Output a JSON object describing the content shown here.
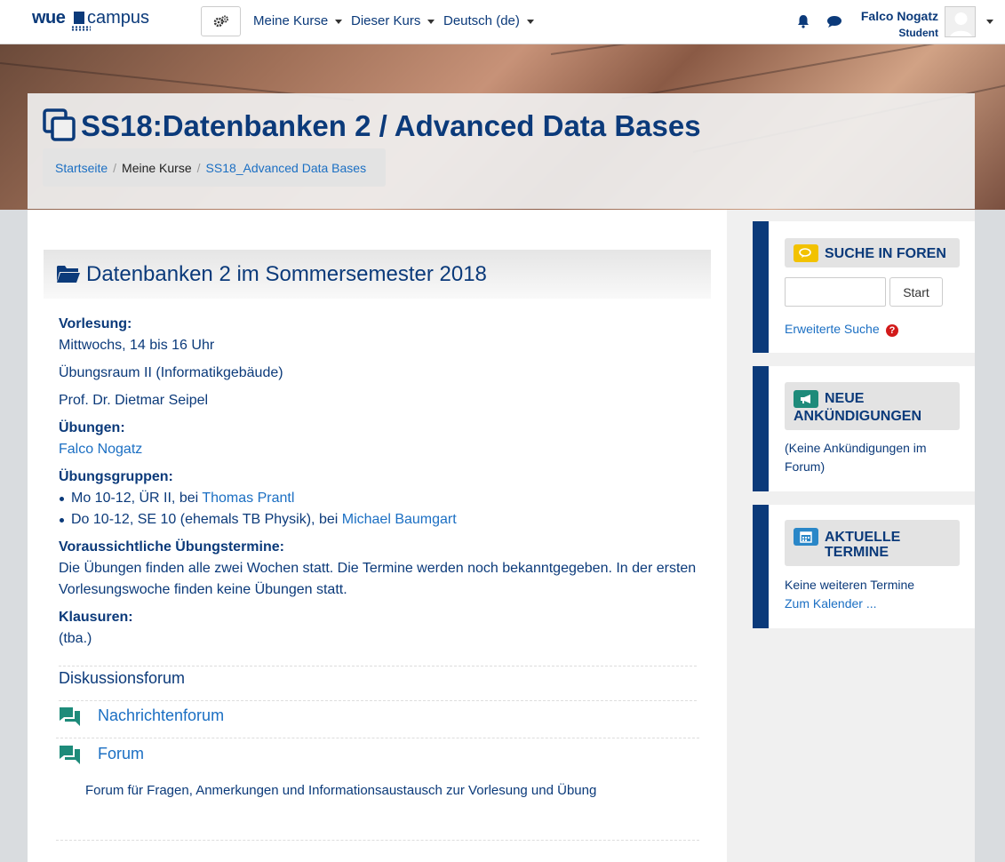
{
  "navbar": {
    "logo_text_bold": "wue",
    "logo_text": "campus",
    "menus": [
      "Meine Kurse",
      "Dieser Kurs",
      "Deutsch (de)"
    ],
    "user_name": "Falco Nogatz",
    "user_role": "Student"
  },
  "header": {
    "title": "SS18:Datenbanken 2 / Advanced Data Bases",
    "breadcrumb": [
      "Startseite",
      "Meine Kurse",
      "SS18_Advanced Data Bases"
    ]
  },
  "section": {
    "title": "Datenbanken 2 im Sommersemester 2018",
    "vorlesung_label": "Vorlesung:",
    "vorlesung_time": "Mittwochs, 14 bis 16 Uhr",
    "vorlesung_room": "Übungsraum II (Informatikgebäude)",
    "vorlesung_prof": "Prof. Dr. Dietmar Seipel",
    "uebungen_label": "Übungen:",
    "uebungen_tutor": "Falco Nogatz",
    "gruppen_label": "Übungsgruppen:",
    "gruppe1_text": "Mo 10-12, ÜR II, bei ",
    "gruppe1_tutor": "Thomas Prantl",
    "gruppe2_text": "Do 10-12, SE 10 (ehemals TB Physik), bei ",
    "gruppe2_tutor": "Michael Baumgart",
    "termine_label": "Voraussichtliche Übungstermine:",
    "termine_line1": "Die Übungen finden alle zwei Wochen statt. Die Termine werden noch bekanntgegeben. In der ersten",
    "termine_line2": "Vorlesungswoche finden keine Übungen statt.",
    "klausuren_label": "Klausuren:",
    "klausuren_value": "(tba.)",
    "diskussion_label": "Diskussionsforum",
    "forum1": "Nachrichtenforum",
    "forum2": "Forum",
    "forum2_desc": "Forum für Fragen, Anmerkungen und Informationsaustausch zur Vorlesung und Übung"
  },
  "blocks": {
    "search": {
      "title": "SUCHE IN FOREN",
      "button": "Start",
      "advanced": "Erweiterte Suche",
      "help": "?"
    },
    "news": {
      "title_line1": "NEUE",
      "title_line2": "ANKÜNDIGUNGEN",
      "empty_line1": "(Keine Ankündigungen im",
      "empty_line2": "Forum)"
    },
    "events": {
      "title_line1": "AKTUELLE",
      "title_line2": "TERMINE",
      "empty": "Keine weiteren Termine",
      "calendar": "Zum Kalender ..."
    }
  },
  "colors": {
    "primary": "#0b3a7a",
    "link": "#1b6fc3",
    "forum_icon": "#1e8b7a",
    "search_badge": "#f2c200",
    "news_badge": "#1e8b7a",
    "events_badge": "#2a87c8"
  }
}
